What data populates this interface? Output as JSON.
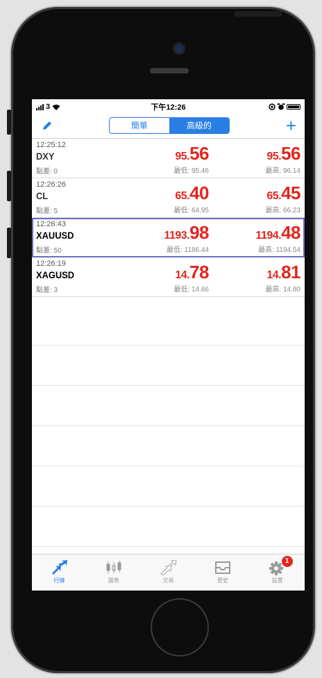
{
  "status_bar": {
    "carrier": "3",
    "time": "下午12:26"
  },
  "toolbar": {
    "segments": [
      {
        "label": "簡單",
        "active": false
      },
      {
        "label": "高級的",
        "active": true
      }
    ],
    "edit_icon": "pencil-icon",
    "add_icon": "plus-icon",
    "accent_color": "#2a7fe4"
  },
  "quotes": [
    {
      "time": "12:25:12",
      "symbol": "DXY",
      "spread": "點差: 0",
      "bid_main": "95.",
      "bid_big": "56",
      "ask_main": "95.",
      "ask_big": "56",
      "low": "最低: 95.46",
      "high": "最高: 96.14",
      "selected": false
    },
    {
      "time": "12:26:26",
      "symbol": "CL",
      "spread": "點差: 5",
      "bid_main": "65.",
      "bid_big": "40",
      "ask_main": "65.",
      "ask_big": "45",
      "low": "最低: 64.95",
      "high": "最高: 66.23",
      "selected": false
    },
    {
      "time": "12:26:43",
      "symbol": "XAUUSD",
      "spread": "點差: 50",
      "bid_main": "1193.",
      "bid_big": "98",
      "ask_main": "1194.",
      "ask_big": "48",
      "low": "最低: 1186.44",
      "high": "最高: 1194.54",
      "selected": true
    },
    {
      "time": "12:26:19",
      "symbol": "XAGUSD",
      "spread": "點差: 3",
      "bid_main": "14.",
      "bid_big": "78",
      "ask_main": "14.",
      "ask_big": "81",
      "low": "最低: 14.66",
      "high": "最高: 14.80",
      "selected": false
    }
  ],
  "price_color": "#e0271d",
  "tabs": [
    {
      "label": "行情",
      "icon": "quotes-arrows-icon",
      "active": true
    },
    {
      "label": "圖表",
      "icon": "candlestick-chart-icon",
      "active": false
    },
    {
      "label": "交易",
      "icon": "trade-arrow-icon",
      "active": false
    },
    {
      "label": "歷史",
      "icon": "inbox-history-icon",
      "active": false
    },
    {
      "label": "設置",
      "icon": "gear-icon",
      "active": false,
      "badge": "1"
    }
  ]
}
